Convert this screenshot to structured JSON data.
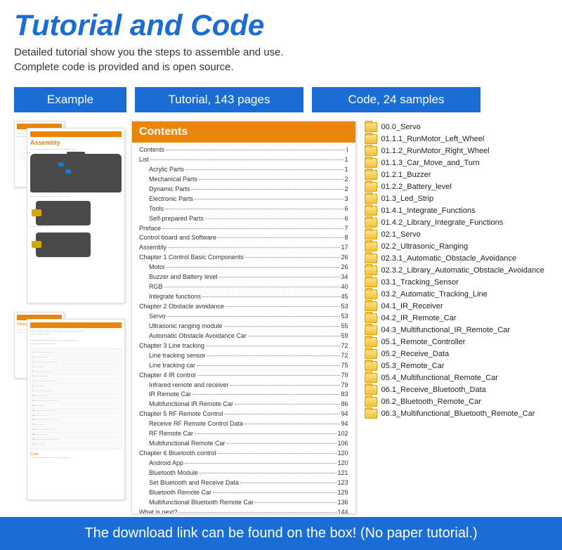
{
  "header": {
    "title": "Tutorial and Code",
    "subtitle1": "Detailed tutorial show you the steps to assemble and use.",
    "subtitle2": "Complete code is provided and is open source."
  },
  "labels": {
    "example": "Example",
    "tutorial": "Tutorial, 143 pages",
    "code": "Code, 24 samples"
  },
  "example": {
    "assembly_title": "Assembly",
    "ultrasonic_title": "Ultrasonic sen"
  },
  "contents_title": "Contents",
  "toc": [
    {
      "label": "Contents",
      "page": "I",
      "indent": 0
    },
    {
      "label": "List",
      "page": "1",
      "indent": 0
    },
    {
      "label": "Acrylic Parts",
      "page": "1",
      "indent": 1
    },
    {
      "label": "Mechanical Parts",
      "page": "2",
      "indent": 1
    },
    {
      "label": "Dynamic Parts",
      "page": "2",
      "indent": 1
    },
    {
      "label": "Electronic Parts",
      "page": "3",
      "indent": 1
    },
    {
      "label": "Tools",
      "page": "6",
      "indent": 1
    },
    {
      "label": "Self-prepared Parts",
      "page": "6",
      "indent": 1
    },
    {
      "label": "Preface",
      "page": "7",
      "indent": 0
    },
    {
      "label": "Control board and Software",
      "page": "8",
      "indent": 0
    },
    {
      "label": "Assembly",
      "page": "17",
      "indent": 0
    },
    {
      "label": "Chapter 1 Control Basic Components",
      "page": "26",
      "indent": 0
    },
    {
      "label": "Motor",
      "page": "26",
      "indent": 1
    },
    {
      "label": "Buzzer and Battery level",
      "page": "34",
      "indent": 1
    },
    {
      "label": "RGB",
      "page": "40",
      "indent": 1
    },
    {
      "label": "Integrate functions",
      "page": "45",
      "indent": 1
    },
    {
      "label": "Chapter 2 Obstacle avoidance",
      "page": "53",
      "indent": 0
    },
    {
      "label": "Servo",
      "page": "53",
      "indent": 1
    },
    {
      "label": "Ultrasonic ranging module",
      "page": "55",
      "indent": 1
    },
    {
      "label": "Automatic Obstacle Avoidance Car",
      "page": "59",
      "indent": 1
    },
    {
      "label": "Chapter 3 Line tracking",
      "page": "72",
      "indent": 0
    },
    {
      "label": "Line tracking sensor",
      "page": "72",
      "indent": 1
    },
    {
      "label": "Line tracking car",
      "page": "75",
      "indent": 1
    },
    {
      "label": "Chapter 4 IR control",
      "page": "79",
      "indent": 0
    },
    {
      "label": "Infrared remote and receiver",
      "page": "79",
      "indent": 1
    },
    {
      "label": "IR Remote Car",
      "page": "83",
      "indent": 1
    },
    {
      "label": "Multifunctional IR Remote Car",
      "page": "86",
      "indent": 1
    },
    {
      "label": "Chapter 5 RF Remote Control",
      "page": "94",
      "indent": 0
    },
    {
      "label": "Receive RF Remote Control Data",
      "page": "94",
      "indent": 1
    },
    {
      "label": "RF Remote Car",
      "page": "102",
      "indent": 1
    },
    {
      "label": "Multifunctional Remote Car",
      "page": "106",
      "indent": 1
    },
    {
      "label": "Chapter 6 Bluetooth control",
      "page": "120",
      "indent": 0
    },
    {
      "label": "Android App",
      "page": "120",
      "indent": 1
    },
    {
      "label": "Bluetooth Module",
      "page": "121",
      "indent": 1
    },
    {
      "label": "Set Bluetooth and Receive Data",
      "page": "123",
      "indent": 1
    },
    {
      "label": "Bluetooth Remote Car",
      "page": "129",
      "indent": 1
    },
    {
      "label": "Multifunctional Bluetooth Remote Car",
      "page": "136",
      "indent": 1
    },
    {
      "label": "What is next?",
      "page": "144",
      "indent": 0
    }
  ],
  "folders": [
    "00.0_Servo",
    "01.1.1_RunMotor_Left_Wheel",
    "01.1.2_RunMotor_Right_Wheel",
    "01.1.3_Car_Move_and_Turn",
    "01.2.1_Buzzer",
    "01.2.2_Battery_level",
    "01.3_Led_Strip",
    "01.4.1_Integrate_Functions",
    "01.4.2_Library_Integrate_Functions",
    "02.1_Servo",
    "02.2_Ultrasonic_Ranging",
    "02.3.1_Automatic_Obstacle_Avoidance",
    "02.3.2_Library_Automatic_Obstacle_Avoidance",
    "03.1_Tracking_Sensor",
    "03.2_Automatic_Tracking_Line",
    "04.1_IR_Receiver",
    "04.2_IR_Remote_Car",
    "04.3_Multifunctional_IR_Remote_Car",
    "05.1_Remote_Controller",
    "05.2_Receive_Data",
    "05.3_Remote_Car",
    "05.4_Multifunctional_Remote_Car",
    "06.1_Receive_Bluetooth_Data",
    "06.2_Bluetooth_Remote_Car",
    "06.3_Multifunctional_Bluetooth_Remote_Car"
  ],
  "footer": "The download link can be found on the box! (No paper tutorial.)"
}
